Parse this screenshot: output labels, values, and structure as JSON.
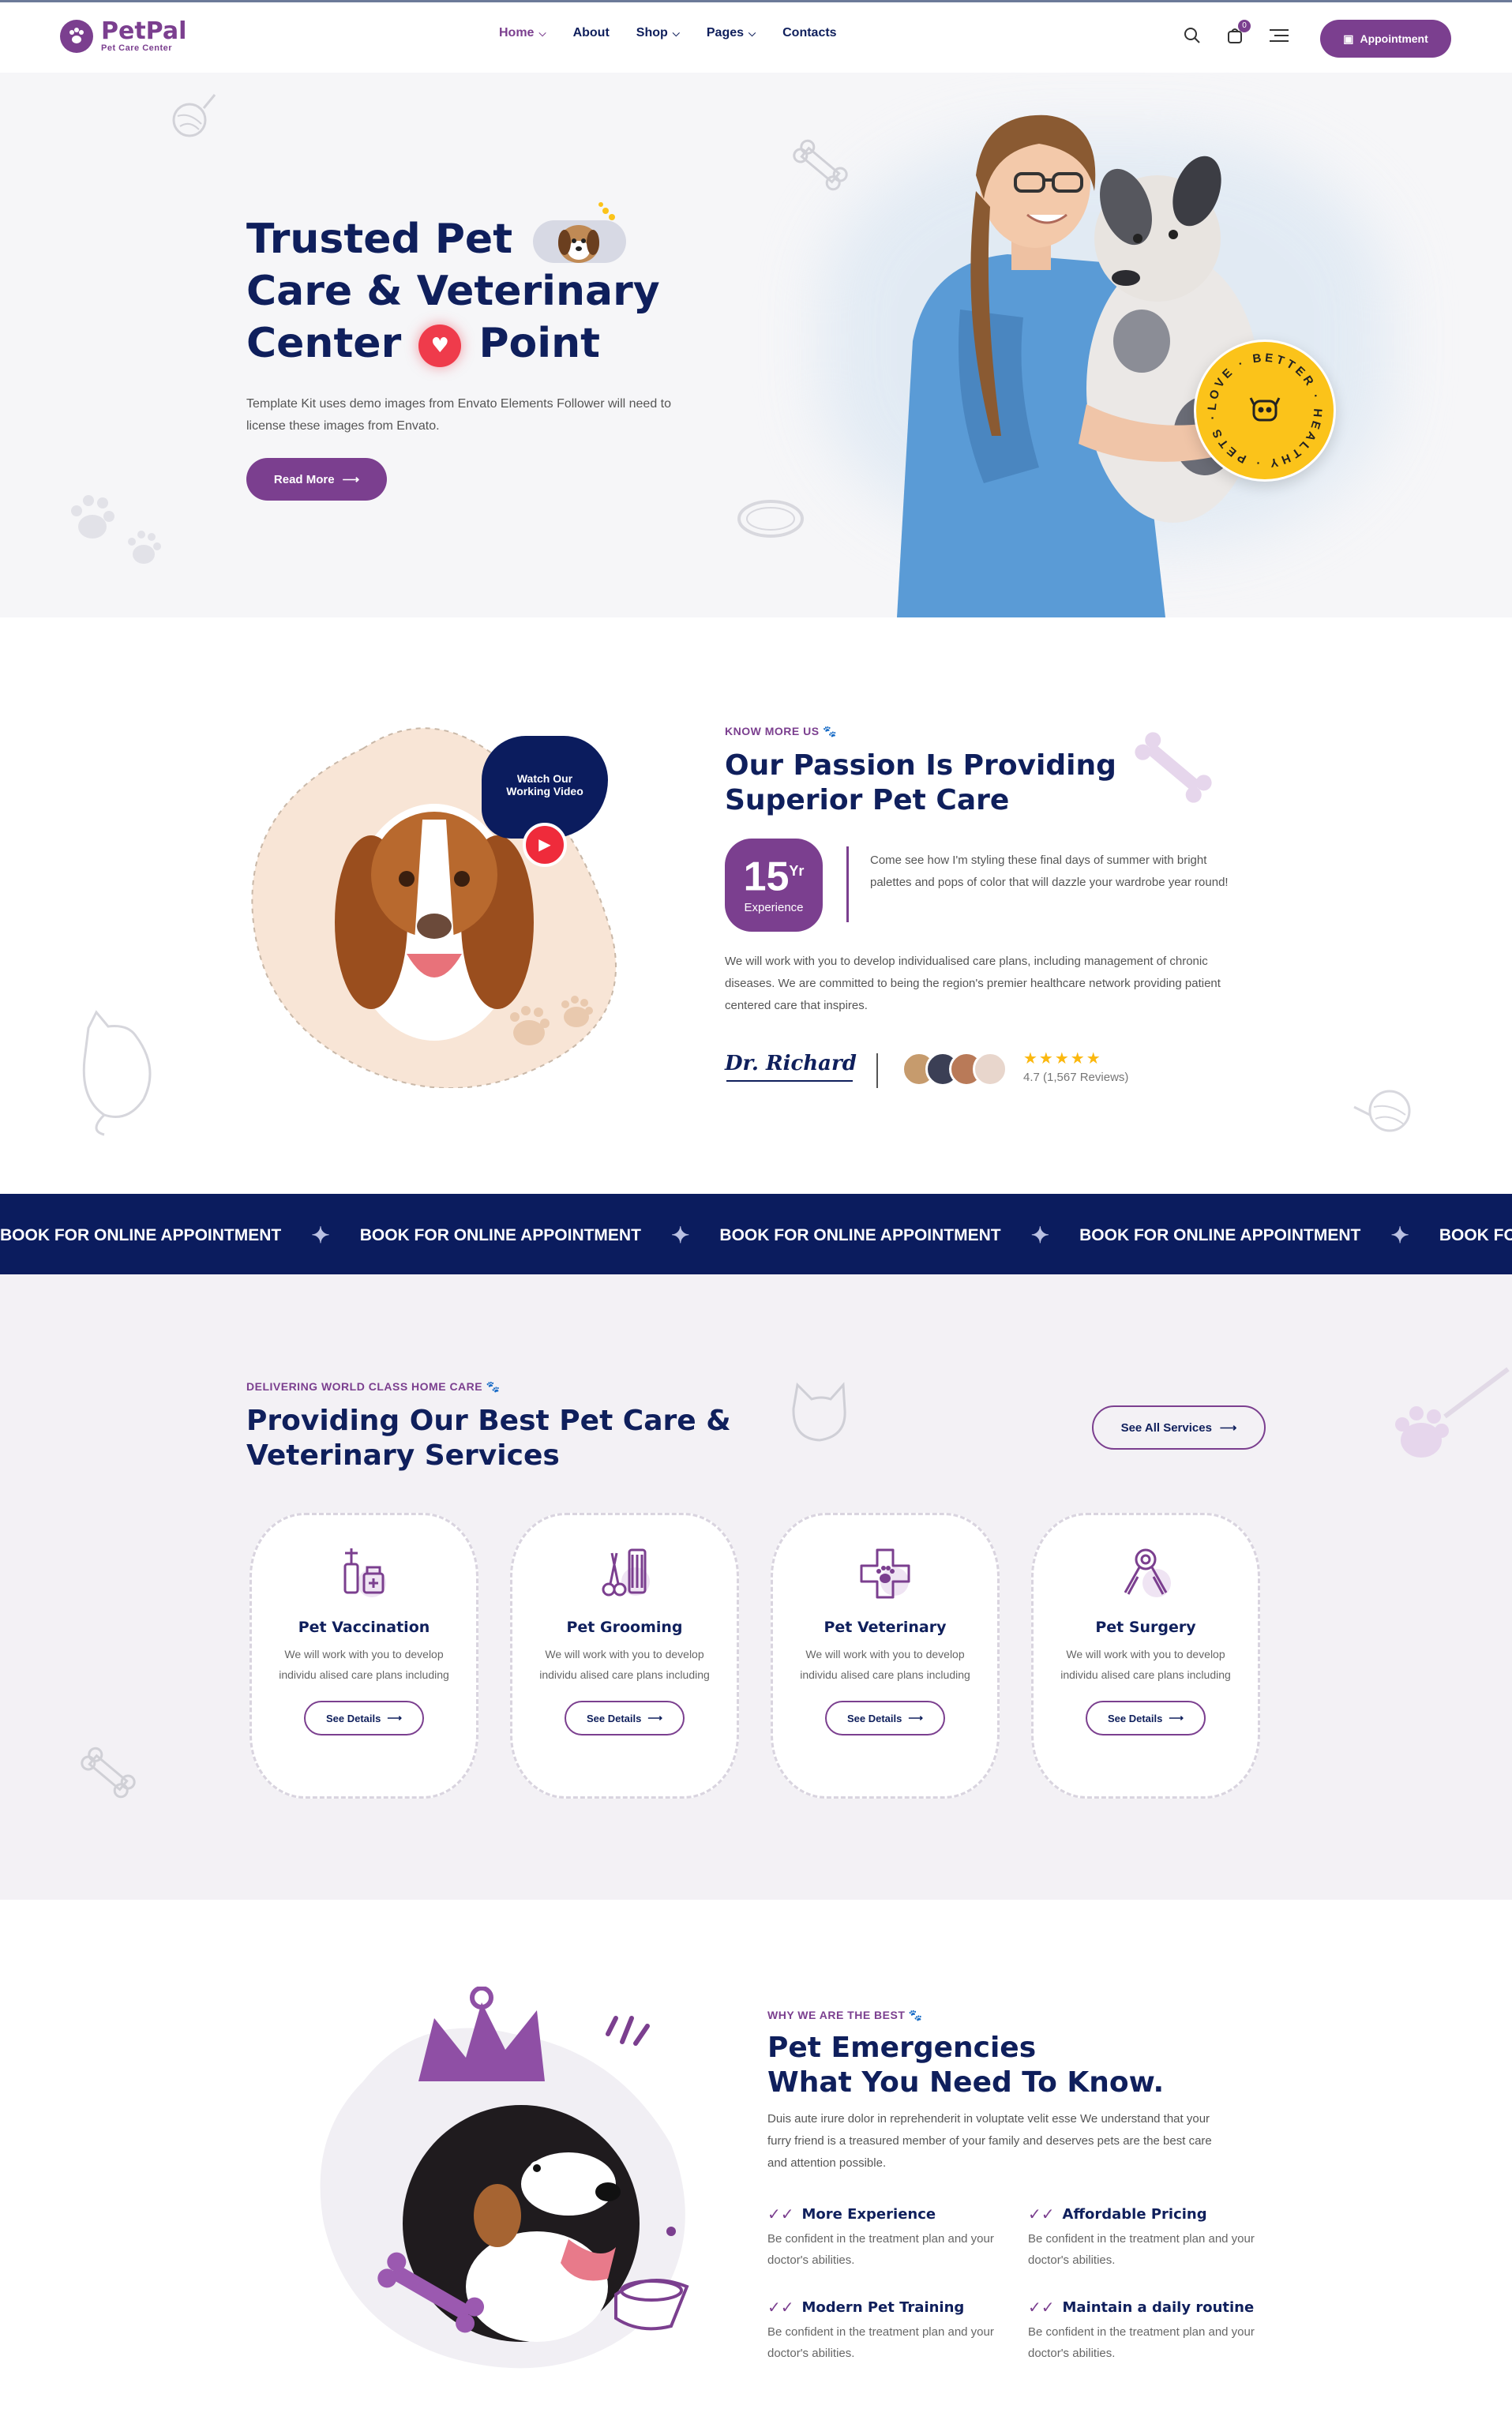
{
  "header": {
    "logo_name": "PetPal",
    "logo_tagline": "Pet Care Center",
    "nav": [
      {
        "label": "Home",
        "has_dropdown": true,
        "active": true
      },
      {
        "label": "About",
        "has_dropdown": false
      },
      {
        "label": "Shop",
        "has_dropdown": true
      },
      {
        "label": "Pages",
        "has_dropdown": true
      },
      {
        "label": "Contacts",
        "has_dropdown": false
      }
    ],
    "cart_count": "0",
    "appointment_label": "Appointment",
    "icons": [
      "search-icon",
      "cart-icon",
      "menu-icon",
      "calendar-icon"
    ]
  },
  "hero": {
    "title_line1": "Trusted Pet",
    "title_line2": "Care & Veterinary",
    "title_line3a": "Center",
    "title_line3b": "Point",
    "description": "Template Kit uses demo images from Envato Elements Follower will need to license these images from Envato.",
    "cta_label": "Read More",
    "badge_text": "LOVE · BETTER · HEALTHY · PETS ·"
  },
  "about": {
    "eyebrow": "KNOW MORE US",
    "title_line1": "Our Passion Is Providing",
    "title_line2": "Superior Pet Care",
    "video_label": "Watch Our Working Video",
    "experience_num": "15",
    "experience_unit": "Yr",
    "experience_label": "Experience",
    "intro": "Come see how I'm styling these final days of summer with bright palettes and pops of color that will dazzle your wardrobe year round!",
    "body": "We will work with you to develop individualised care plans, including management of chronic diseases. We are committed to being the region's premier healthcare network providing patient centered care that inspires.",
    "signature": "Dr. Richard",
    "rating_stars": "★★★★★",
    "rating": 4.7,
    "rating_text": "4.7 (1,567 Reviews)"
  },
  "marquee": {
    "text": "BOOK FOR ONLINE APPOINTMENT",
    "items": [
      "BOOK FOR ONLINE APPOINTMENT",
      "BOOK FOR ONLINE APPOINTMENT",
      "BOOK FOR ONLINE APPOINTMENT",
      "BOOK FOR ONLINE APPOINTMENT",
      "BOOK FOR ONLINE APPOINTMENT"
    ]
  },
  "services": {
    "eyebrow": "DELIVERING WORLD CLASS HOME CARE",
    "title_line1": "Providing Our Best Pet Care &",
    "title_line2": "Veterinary Services",
    "see_all_label": "See All Services",
    "cards": [
      {
        "title": "Pet Vaccination",
        "text": "We will work with you to develop individu alised care plans including",
        "button": "See Details",
        "icon": "vaccine-icon"
      },
      {
        "title": "Pet Grooming",
        "text": "We will work with you to develop individu alised care plans including",
        "button": "See Details",
        "icon": "grooming-icon"
      },
      {
        "title": "Pet Veterinary",
        "text": "We will work with you to develop individu alised care plans including",
        "button": "See Details",
        "icon": "veterinary-icon"
      },
      {
        "title": "Pet Surgery",
        "text": "We will work with you to develop individu alised care plans including",
        "button": "See Details",
        "icon": "surgery-icon"
      }
    ]
  },
  "why": {
    "eyebrow": "WHY WE ARE THE BEST",
    "title_line1": "Pet Emergencies",
    "title_line2": "What You Need To Know.",
    "body": "Duis aute irure dolor in reprehenderit in voluptate velit esse We understand that your furry friend is a treasured member of your family and deserves pets are the best care and attention possible.",
    "features": [
      {
        "title": "More Experience",
        "text": "Be confident in the treatment plan and your doctor's abilities."
      },
      {
        "title": "Affordable Pricing",
        "text": "Be confident in the treatment plan and your doctor's abilities."
      },
      {
        "title": "Modern Pet Training",
        "text": "Be confident in the treatment plan and your doctor's abilities."
      },
      {
        "title": "Maintain a daily routine",
        "text": "Be confident in the treatment plan and your doctor's abilities."
      }
    ]
  },
  "colors": {
    "primary": "#7b3f8f",
    "navy": "#0f1f5c",
    "marquee_bg": "#0b1c5e",
    "badge_yellow": "#fbc31a",
    "heart_red": "#ef3b4b"
  }
}
